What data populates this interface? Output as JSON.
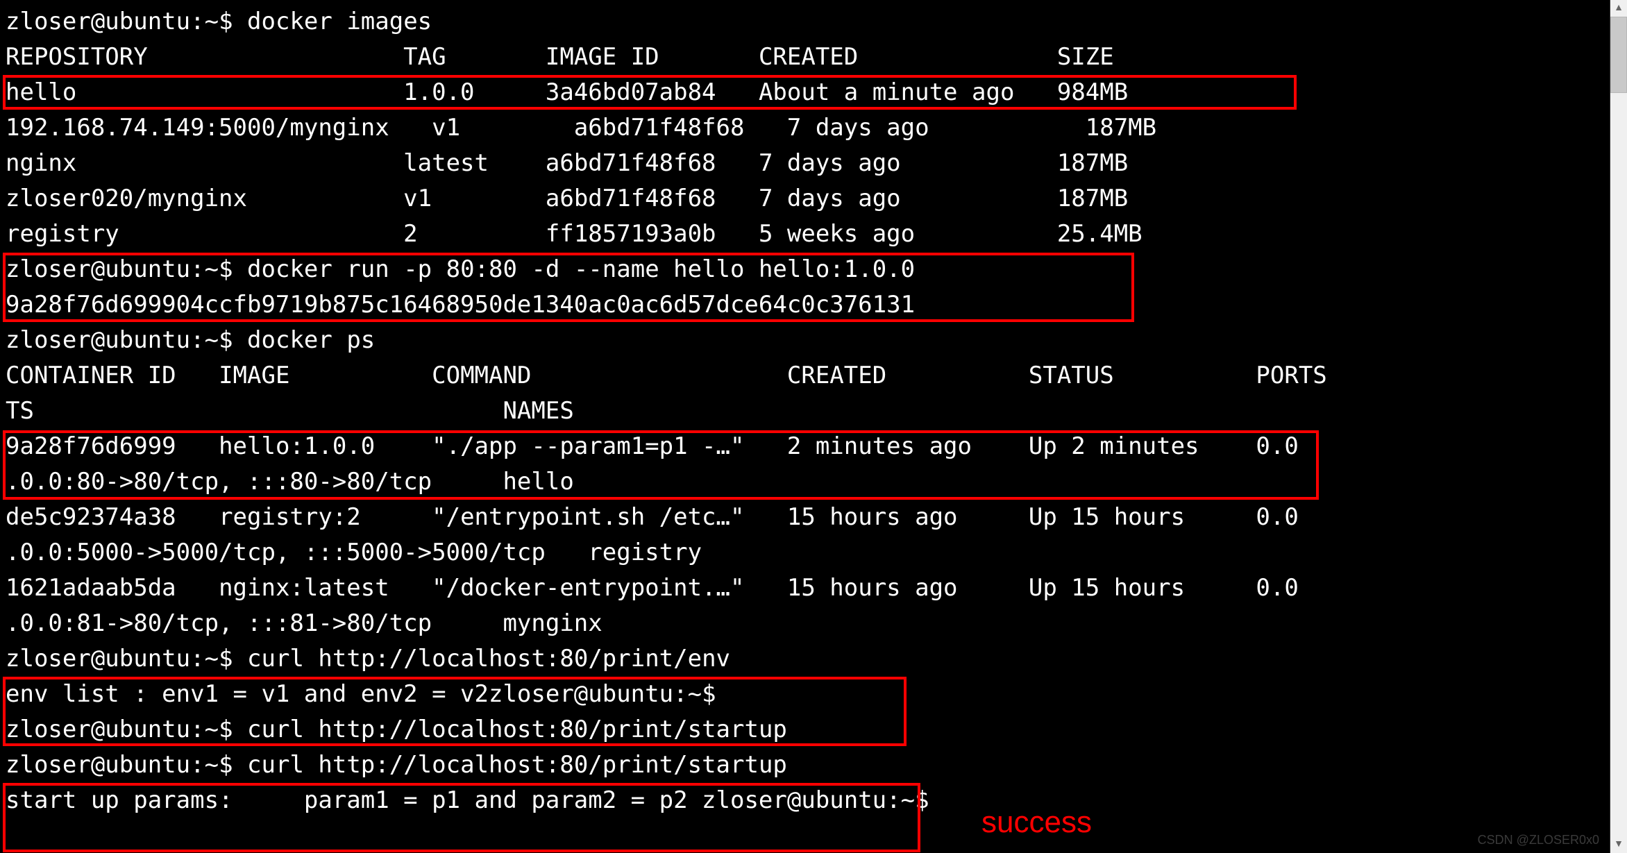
{
  "prompt": {
    "user": "zloser@ubuntu",
    "sep": ":",
    "path": "~",
    "sym": "$"
  },
  "cmd": {
    "images": "docker images",
    "run": "docker run -p 80:80 -d --name hello hello:1.0.0",
    "ps": "docker ps",
    "curl_env": "curl http://localhost:80/print/env",
    "curl_startup": "curl http://localhost:80/print/startup"
  },
  "images_header": {
    "repository": "REPOSITORY",
    "tag": "TAG",
    "image_id": "IMAGE ID",
    "created": "CREATED",
    "size": "SIZE"
  },
  "images": [
    {
      "repository": "hello",
      "tag": "1.0.0",
      "image_id": "3a46bd07ab84",
      "created": "About a minute ago",
      "size": "984MB"
    },
    {
      "repository": "192.168.74.149:5000/mynginx",
      "tag": "v1",
      "image_id": "a6bd71f48f68",
      "created": "7 days ago",
      "size": "187MB"
    },
    {
      "repository": "nginx",
      "tag": "latest",
      "image_id": "a6bd71f48f68",
      "created": "7 days ago",
      "size": "187MB"
    },
    {
      "repository": "zloser020/mynginx",
      "tag": "v1",
      "image_id": "a6bd71f48f68",
      "created": "7 days ago",
      "size": "187MB"
    },
    {
      "repository": "registry",
      "tag": "2",
      "image_id": "ff1857193a0b",
      "created": "5 weeks ago",
      "size": "25.4MB"
    }
  ],
  "run_output": "9a28f76d699904ccfb9719b875c16468950de1340ac0ac6d57dce64c0c376131",
  "ps_header": {
    "container_id": "CONTAINER ID",
    "image": "IMAGE",
    "command": "COMMAND",
    "created": "CREATED",
    "status": "STATUS",
    "ports": "PORTS",
    "names": "NAMES"
  },
  "ps": [
    {
      "container_id": "9a28f76d6999",
      "image": "hello:1.0.0",
      "command": "\"./app --param1=p1 -…\"",
      "created": "2 minutes ago",
      "status": "Up 2 minutes",
      "ports_line1": "0.0",
      "ports_line2": ".0.0:80->80/tcp, :::80->80/tcp",
      "names": "hello"
    },
    {
      "container_id": "de5c92374a38",
      "image": "registry:2",
      "command": "\"/entrypoint.sh /etc…\"",
      "created": "15 hours ago",
      "status": "Up 15 hours",
      "ports_line1": "0.0",
      "ports_line2": ".0.0:5000->5000/tcp, :::5000->5000/tcp",
      "names": "registry"
    },
    {
      "container_id": "1621adaab5da",
      "image": "nginx:latest",
      "command": "\"/docker-entrypoint.…\"",
      "created": "15 hours ago",
      "status": "Up 15 hours",
      "ports_line1": "0.0",
      "ports_line2": ".0.0:81->80/tcp, :::81->80/tcp",
      "names": "mynginx"
    }
  ],
  "curl_env_output_prefix": "env list : env1 = v1 and env2 = v2",
  "curl_startup_output_prefix": "start up params:     param1 = p1 and param2 = p2 ",
  "annotation": {
    "success": "success"
  },
  "watermark": "CSDN @ZLOSER0x0"
}
